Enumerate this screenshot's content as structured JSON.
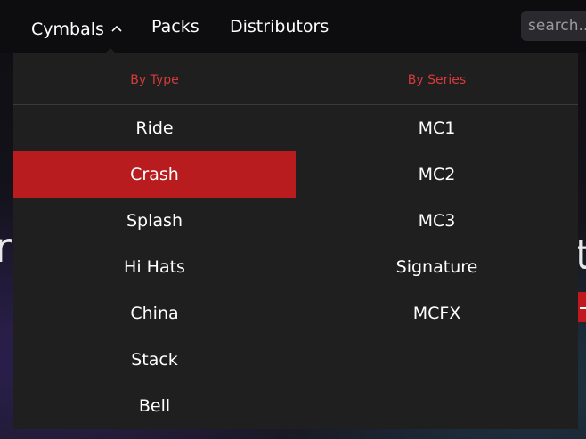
{
  "nav": {
    "cymbals_label": "Cymbals",
    "packs_label": "Packs",
    "distributors_label": "Distributors",
    "search_placeholder": "search..."
  },
  "dropdown": {
    "by_type_header": "By Type",
    "by_series_header": "By Series",
    "type_items": [
      {
        "label": "Ride"
      },
      {
        "label": "Crash",
        "active": true
      },
      {
        "label": "Splash"
      },
      {
        "label": "Hi Hats"
      },
      {
        "label": "China"
      },
      {
        "label": "Stack"
      },
      {
        "label": "Bell"
      }
    ],
    "series_items": [
      {
        "label": "MC1"
      },
      {
        "label": "MC2"
      },
      {
        "label": "MC3"
      },
      {
        "label": "Signature"
      },
      {
        "label": "MCFX"
      }
    ]
  },
  "hero": {
    "left_fragment": "r",
    "right_fragment": "t"
  },
  "colors": {
    "accent_red": "#b91c1e",
    "header_red": "#d63a3a",
    "dropdown_bg": "#1f1f1f",
    "nav_bg": "#0d0d10"
  },
  "icons": {
    "cymbals_chevron": "chevron-up-icon"
  }
}
